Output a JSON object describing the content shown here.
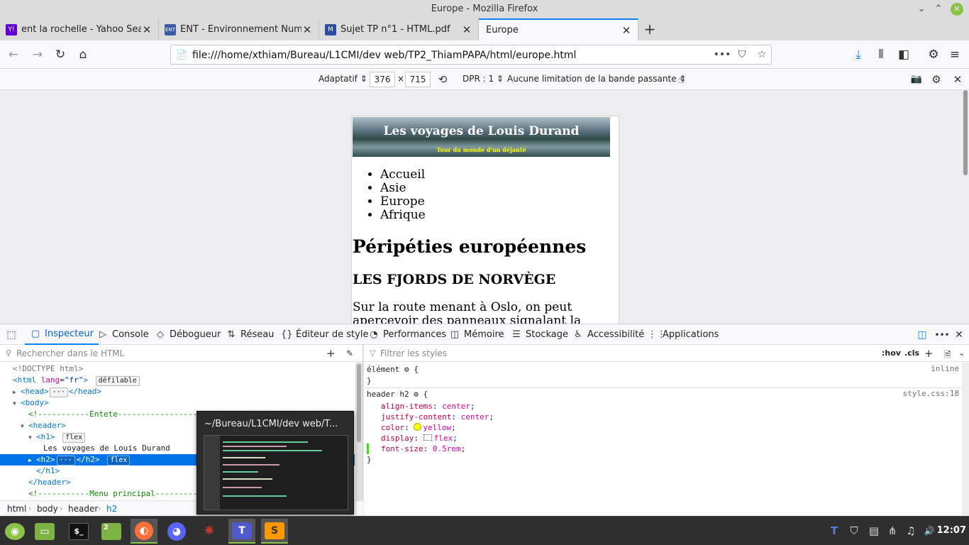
{
  "window": {
    "title": "Europe - Mozilla Firefox",
    "minimize": "⌄",
    "restore": "⌃",
    "close": "✕"
  },
  "tabs": [
    {
      "label": "ent la rochelle - Yahoo Search",
      "favicon": "Y!",
      "favicon_color": "#6001d2",
      "close": "✕"
    },
    {
      "label": "ENT - Environnement Numérique",
      "favicon": "ENT",
      "favicon_color": "#3a5ba8",
      "close": "✕"
    },
    {
      "label": "Sujet TP n°1 - HTML.pdf",
      "favicon": "M",
      "favicon_color": "#2b4ea0",
      "close": "✕"
    },
    {
      "label": "Europe",
      "favicon": "",
      "favicon_color": "",
      "close": "✕",
      "active": true
    }
  ],
  "newtab": "+",
  "nav": {
    "back": "←",
    "forward": "→",
    "reload": "↻",
    "home": "⌂",
    "url": "file:///home/xthiam/Bureau/L1CMI/dev web/TP2_ThiamPAPA/html/europe.html",
    "url_icon": "📄",
    "more": "•••",
    "pocket": "⛉",
    "bookmark": "☆",
    "download": "⤓",
    "library": "⫴",
    "sidebar": "◧",
    "extensions": "⚙",
    "menu": "≡"
  },
  "rdm": {
    "device": "Adaptatif ⇕",
    "width": "376",
    "times": "×",
    "height": "715",
    "rotate": "⟲",
    "dpr": "DPR : 1 ⇕",
    "throttle": "Aucune limitation de la bande passante ⇕",
    "touch": "☝",
    "screenshot": "📷",
    "settings": "⚙",
    "close": "✕"
  },
  "page": {
    "title": "Les voyages de Louis Durand",
    "subtitle": "Tour du monde d'un déjanté",
    "menu": [
      "Accueil",
      "Asie",
      "Europe",
      "Afrique"
    ],
    "heading": "Péripéties européennes",
    "section": "LES FJORDS DE NORVÈGE",
    "paragraph": "Sur la route menant à Oslo, on peut apercevoir des panneaux signalant la"
  },
  "devtools": {
    "picker": "⬚",
    "tabs": [
      {
        "label": "Inspecteur",
        "icon": "▢",
        "active": true
      },
      {
        "label": "Console",
        "icon": "▷"
      },
      {
        "label": "Débogueur",
        "icon": "◇"
      },
      {
        "label": "Réseau",
        "icon": "⇅"
      },
      {
        "label": "Éditeur de style",
        "icon": "{}"
      },
      {
        "label": "Performances",
        "icon": "◔"
      },
      {
        "label": "Mémoire",
        "icon": "◫"
      },
      {
        "label": "Stockage",
        "icon": "☰"
      },
      {
        "label": "Accessibilité",
        "icon": "♿"
      },
      {
        "label": "Applications",
        "icon": "⋮⋮"
      }
    ],
    "dock": "◫",
    "more": "•••",
    "close": "✕",
    "markup_search": "Rechercher dans le HTML",
    "add_node": "+",
    "eyedropper": "✎",
    "styles_filter": "Filtrer les styles",
    "hov": ":hov",
    "cls": ".cls",
    "add_rule": "+",
    "print": "🗎",
    "expand": "⌄",
    "tree": {
      "doctype": "<!DOCTYPE html>",
      "html_open": "<html",
      "html_attr": "lang",
      "html_val": "\"fr\"",
      "html_close": ">",
      "html_badge": "défilable",
      "head": "<head>",
      "head_dots": "···",
      "head_close": "</head>",
      "body": "<body>",
      "comment1": "<!-----------Entete--------------------",
      "header": "<header>",
      "h1": "<h1>",
      "h1_badge": "flex",
      "h1_text": "Les voyages de Louis Durand",
      "h2": "<h2>",
      "h2_dots": "···",
      "h2_close": "</h2>",
      "h2_badge": "flex",
      "h1_end": "</h1>",
      "header_end": "</header>",
      "comment2": "<!-----------Menu principal----------"
    },
    "breadcrumbs": [
      "html",
      "body",
      "header",
      "h2"
    ],
    "rules": {
      "element_selector": "élément",
      "element_source": "inline",
      "selector": "header h2",
      "source": "style.css:18",
      "props": [
        {
          "name": "align-items",
          "value": "center"
        },
        {
          "name": "justify-content",
          "value": "center"
        },
        {
          "name": "color",
          "value": "yellow"
        },
        {
          "name": "display",
          "value": "flex"
        },
        {
          "name": "font-size",
          "value": "0.5rem"
        }
      ],
      "open": "{",
      "close": "}"
    }
  },
  "popup": {
    "title": "~/Bureau/L1CMI/dev web/T..."
  },
  "taskbar": {
    "apps": [
      {
        "name": "mint-menu",
        "glyph": "◉"
      },
      {
        "name": "files",
        "glyph": "▭"
      },
      {
        "name": "terminal",
        "glyph": "$_"
      },
      {
        "name": "folder",
        "glyph": "2"
      },
      {
        "name": "firefox",
        "glyph": "◐"
      },
      {
        "name": "discord",
        "glyph": "◕"
      },
      {
        "name": "spider",
        "glyph": "✷"
      },
      {
        "name": "teams",
        "glyph": "T"
      },
      {
        "name": "sublime",
        "glyph": "S"
      }
    ],
    "tray": [
      "T",
      "⛉",
      "▤",
      "⋔",
      "♫",
      "🔊"
    ],
    "clock": "12:07"
  }
}
